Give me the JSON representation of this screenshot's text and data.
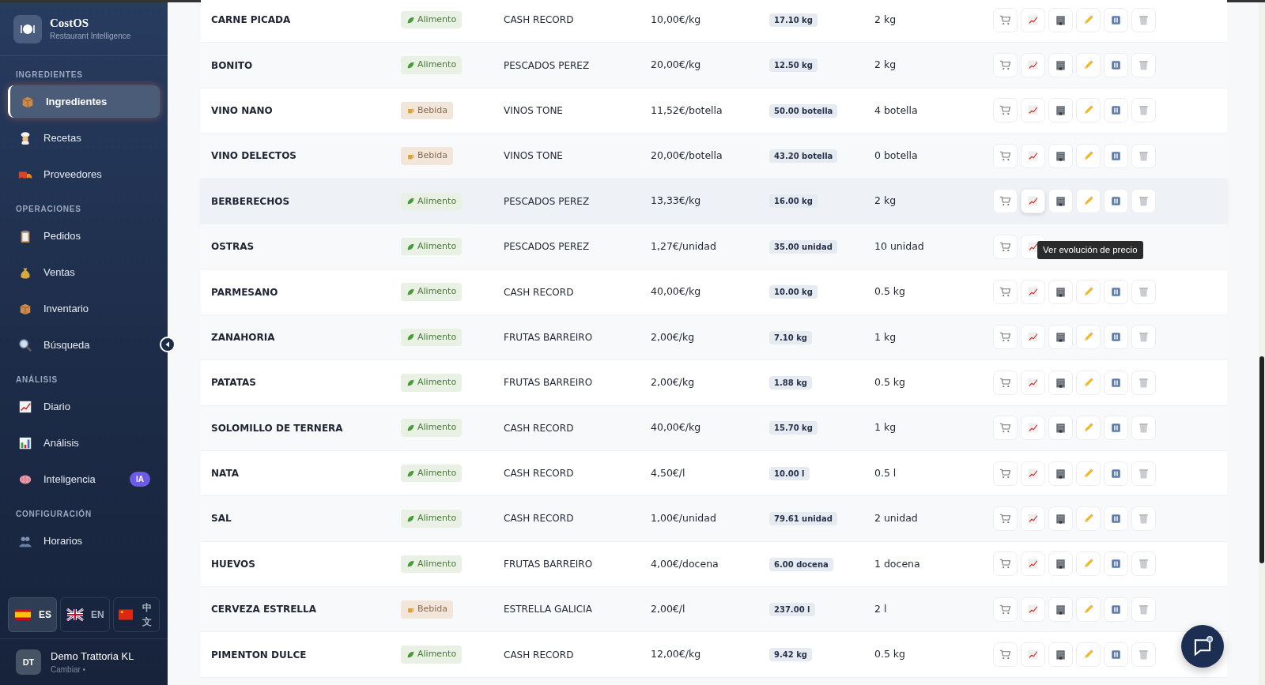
{
  "brand": {
    "title": "CostOS",
    "subtitle": "Restaurant Intelligence"
  },
  "sidebar": {
    "sections": [
      {
        "label": "INGREDIENTES",
        "items": [
          {
            "label": "Ingredientes",
            "selected": true
          },
          {
            "label": "Recetas",
            "selected": false
          },
          {
            "label": "Proveedores",
            "selected": false
          }
        ]
      },
      {
        "label": "OPERACIONES",
        "items": [
          {
            "label": "Pedidos",
            "selected": false
          },
          {
            "label": "Ventas",
            "selected": false
          },
          {
            "label": "Inventario",
            "selected": false
          },
          {
            "label": "Búsqueda",
            "selected": false
          }
        ]
      },
      {
        "label": "ANÁLISIS",
        "items": [
          {
            "label": "Diario",
            "selected": false
          },
          {
            "label": "Análisis",
            "selected": false
          },
          {
            "label": "Inteligencia",
            "selected": false,
            "badge": "IA"
          }
        ]
      },
      {
        "label": "CONFIGURACIÓN",
        "items": [
          {
            "label": "Horarios",
            "selected": false
          }
        ]
      }
    ]
  },
  "languages": [
    {
      "code": "ES",
      "selected": true
    },
    {
      "code": "EN",
      "selected": false
    },
    {
      "code": "中文",
      "selected": false
    }
  ],
  "user": {
    "initials": "DT",
    "name": "Demo Trattoria KL",
    "action": "Cambiar •"
  },
  "rows": [
    {
      "name": "CARNE PICADA",
      "category": "Alimento",
      "kind": "food",
      "supplier": "CASH RECORD",
      "price": "10,00€/kg",
      "stock": "17.10 kg",
      "minimum": "2 kg",
      "highlighted": false
    },
    {
      "name": "BONITO",
      "category": "Alimento",
      "kind": "food",
      "supplier": "PESCADOS PEREZ",
      "price": "20,00€/kg",
      "stock": "12.50 kg",
      "minimum": "2 kg",
      "highlighted": false
    },
    {
      "name": "VINO NANO",
      "category": "Bebida",
      "kind": "drink",
      "supplier": "VINOS TONE",
      "price": "11,52€/botella",
      "stock": "50.00 botella",
      "minimum": "4 botella",
      "highlighted": false
    },
    {
      "name": "VINO DELECTOS",
      "category": "Bebida",
      "kind": "drink",
      "supplier": "VINOS TONE",
      "price": "20,00€/botella",
      "stock": "43.20 botella",
      "minimum": "0 botella",
      "highlighted": false
    },
    {
      "name": "BERBERECHOS",
      "category": "Alimento",
      "kind": "food",
      "supplier": "PESCADOS PEREZ",
      "price": "13,33€/kg",
      "stock": "16.00 kg",
      "minimum": "2 kg",
      "highlighted": true
    },
    {
      "name": "OSTRAS",
      "category": "Alimento",
      "kind": "food",
      "supplier": "PESCADOS PEREZ",
      "price": "1,27€/unidad",
      "stock": "35.00 unidad",
      "minimum": "10 unidad",
      "highlighted": false,
      "tooltip": "Ver evolución de precio"
    },
    {
      "name": "PARMESANO",
      "category": "Alimento",
      "kind": "food",
      "supplier": "CASH RECORD",
      "price": "40,00€/kg",
      "stock": "10.00 kg",
      "minimum": "0.5 kg",
      "highlighted": false
    },
    {
      "name": "ZANAHORIA",
      "category": "Alimento",
      "kind": "food",
      "supplier": "FRUTAS BARREIRO",
      "price": "2,00€/kg",
      "stock": "7.10 kg",
      "minimum": "1 kg",
      "highlighted": false
    },
    {
      "name": "PATATAS",
      "category": "Alimento",
      "kind": "food",
      "supplier": "FRUTAS BARREIRO",
      "price": "2,00€/kg",
      "stock": "1.88 kg",
      "minimum": "0.5 kg",
      "highlighted": false
    },
    {
      "name": "SOLOMILLO DE TERNERA",
      "category": "Alimento",
      "kind": "food",
      "supplier": "CASH RECORD",
      "price": "40,00€/kg",
      "stock": "15.70 kg",
      "minimum": "1 kg",
      "highlighted": false
    },
    {
      "name": "NATA",
      "category": "Alimento",
      "kind": "food",
      "supplier": "CASH RECORD",
      "price": "4,50€/l",
      "stock": "10.00 l",
      "minimum": "0.5 l",
      "highlighted": false
    },
    {
      "name": "SAL",
      "category": "Alimento",
      "kind": "food",
      "supplier": "CASH RECORD",
      "price": "1,00€/unidad",
      "stock": "79.61 unidad",
      "minimum": "2 unidad",
      "highlighted": false
    },
    {
      "name": "HUEVOS",
      "category": "Alimento",
      "kind": "food",
      "supplier": "FRUTAS BARREIRO",
      "price": "4,00€/docena",
      "stock": "6.00 docena",
      "minimum": "1 docena",
      "highlighted": false
    },
    {
      "name": "CERVEZA ESTRELLA",
      "category": "Bebida",
      "kind": "drink",
      "supplier": "ESTRELLA GALICIA",
      "price": "2,00€/l",
      "stock": "237.00 l",
      "minimum": "2 l",
      "highlighted": false
    },
    {
      "name": "PIMENTON DULCE",
      "category": "Alimento",
      "kind": "food",
      "supplier": "CASH RECORD",
      "price": "12,00€/kg",
      "stock": "9.42 kg",
      "minimum": "0.5 kg",
      "highlighted": false
    }
  ]
}
